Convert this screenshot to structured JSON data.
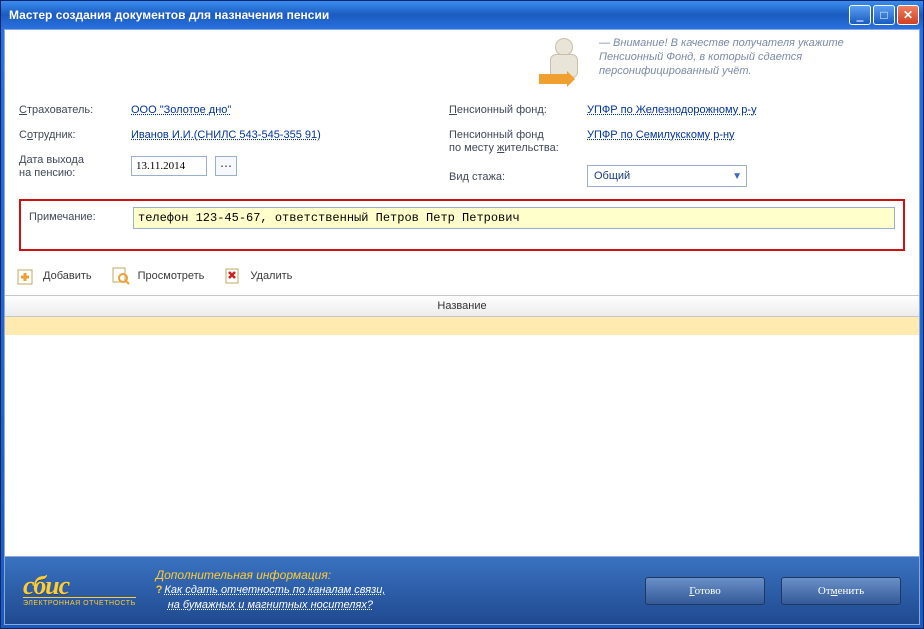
{
  "window": {
    "title": "Мастер создания документов для назначения пенсии"
  },
  "hint": "— Внимание! В качестве получателя укажите Пенсионный Фонд, в который сдается персонифицированный учёт.",
  "labels": {
    "insurer": "Страхователь:",
    "employee": "Сотрудник:",
    "retire_date": "Дата выхода на пенсию:",
    "note": "Примечание:",
    "fund": "Пенсионный фонд:",
    "fund_residence": "Пенсионный фонд по месту жительства:",
    "stage_type": "Вид стажа:"
  },
  "values": {
    "insurer": "ООО \"Золотое дно\"",
    "employee": "Иванов И.И.(СНИЛС 543-545-355 91)",
    "retire_date": "13.11.2014",
    "fund": "УПФР по Железнодорожному р-у",
    "fund_residence": "УПФР по Семилукскому р-ну",
    "stage_type": "Общий",
    "note": "телефон 123-45-67, ответственный Петров Петр Петрович"
  },
  "toolbar": {
    "add": "Добавить",
    "view": "Просмотреть",
    "delete": "Удалить"
  },
  "grid": {
    "header": "Название"
  },
  "footer": {
    "logo": "сбис",
    "logo_sub": "ЭЛЕКТРОННАЯ ОТЧЕТНОСТЬ",
    "info_title": "Дополнительная информация:",
    "info_line1": "Как сдать отчетность по каналам связи,",
    "info_line2": "на бумажных и магнитных носителях?",
    "done": "Готово",
    "cancel": "Отменить"
  }
}
